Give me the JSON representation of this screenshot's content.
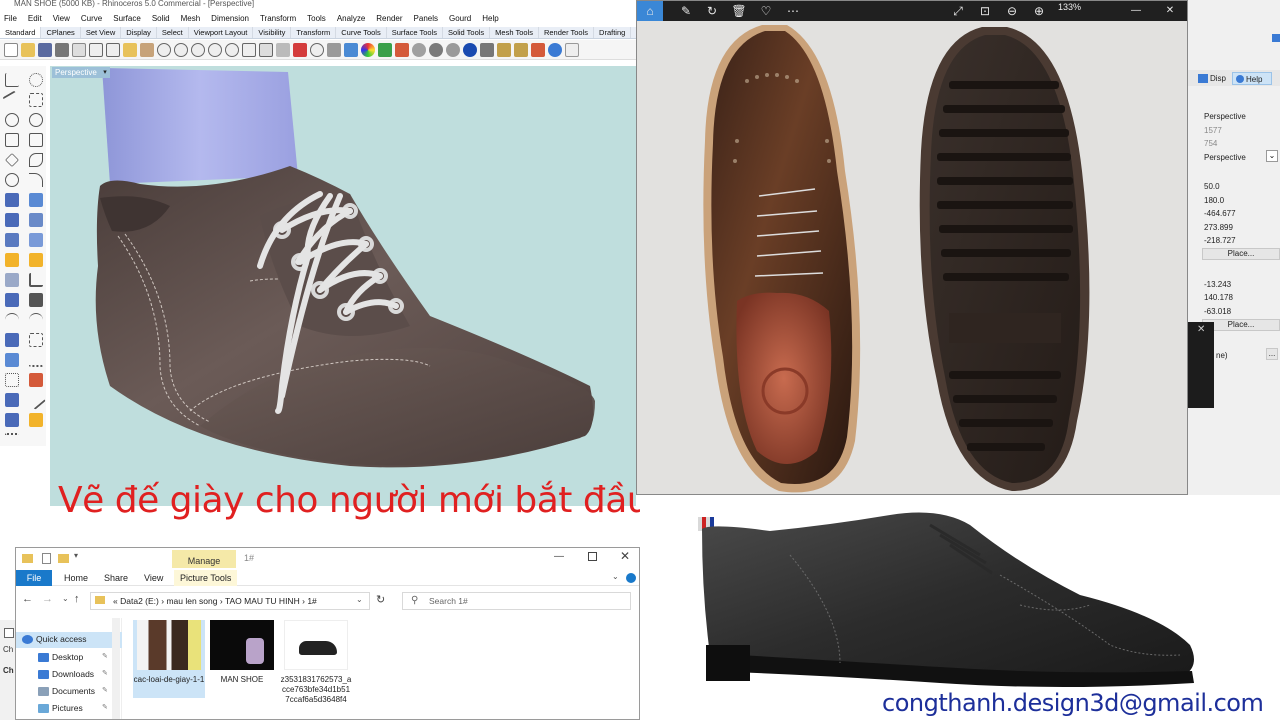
{
  "rhino": {
    "title": "MAN SHOE (5000 KB) - Rhinoceros 5.0 Commercial - [Perspective]",
    "menu": [
      "File",
      "Edit",
      "View",
      "Curve",
      "Surface",
      "Solid",
      "Mesh",
      "Dimension",
      "Transform",
      "Tools",
      "Analyze",
      "Render",
      "Panels",
      "Gourd",
      "Help"
    ],
    "toolbar_tabs": [
      "Standard",
      "CPlanes",
      "Set View",
      "Display",
      "Select",
      "Viewport Layout",
      "Visibility",
      "Transform",
      "Curve Tools",
      "Surface Tools",
      "Solid Tools",
      "Mesh Tools",
      "Render Tools",
      "Drafting"
    ],
    "viewport_label": "Perspective",
    "viewport_arrow": "▾",
    "headline": "Vẽ đế giày cho người mới bắt đầu"
  },
  "left_strip": {
    "ch1": "Ch",
    "ch2": "Ch"
  },
  "explorer": {
    "manage_tab": "Manage",
    "window_title": "1#",
    "ribbon": {
      "file": "File",
      "home": "Home",
      "share": "Share",
      "view": "View",
      "picture_tools": "Picture Tools"
    },
    "address": {
      "prefix": "«",
      "segments": [
        "Data2 (E:)",
        "mau len song",
        "TAO MAU TU HINH",
        "1#"
      ],
      "separator": "›"
    },
    "search_placeholder": "Search 1#",
    "nav": [
      {
        "label": "Quick access",
        "icon": "star-icon"
      },
      {
        "label": "Desktop",
        "icon": "desktop-icon"
      },
      {
        "label": "Downloads",
        "icon": "download-icon"
      },
      {
        "label": "Documents",
        "icon": "documents-icon"
      },
      {
        "label": "Pictures",
        "icon": "pictures-icon"
      }
    ],
    "files": [
      {
        "name": "cac-loai-de-giay-1-1"
      },
      {
        "name": "MAN SHOE"
      },
      {
        "name": "z3531831762573_acce763bfe34d1b517ccaf6a5d3648f4"
      }
    ]
  },
  "photos": {
    "zoom": "133%"
  },
  "right_panel": {
    "tabs": [
      "Disp",
      "Help"
    ],
    "title": "Perspective",
    "w": "1577",
    "h": "754",
    "projection": "Perspective",
    "lens": "50.0",
    "rotation": "180.0",
    "cam_x": "-464.677",
    "cam_y": "273.899",
    "cam_z": "-218.727",
    "place1": "Place...",
    "tgt_x": "-13.243",
    "tgt_y": "140.178",
    "tgt_z": "-63.018",
    "place2": "Place...",
    "misc": "ne)",
    "misc_btn": "..."
  },
  "watermark": {
    "email": "congthanh.design3d@gmail.com"
  },
  "colors": {
    "headline": "#e02020",
    "viewport_bg": "#bfdedd",
    "explorer_accent": "#1979ca",
    "email": "#1d2f9a"
  }
}
